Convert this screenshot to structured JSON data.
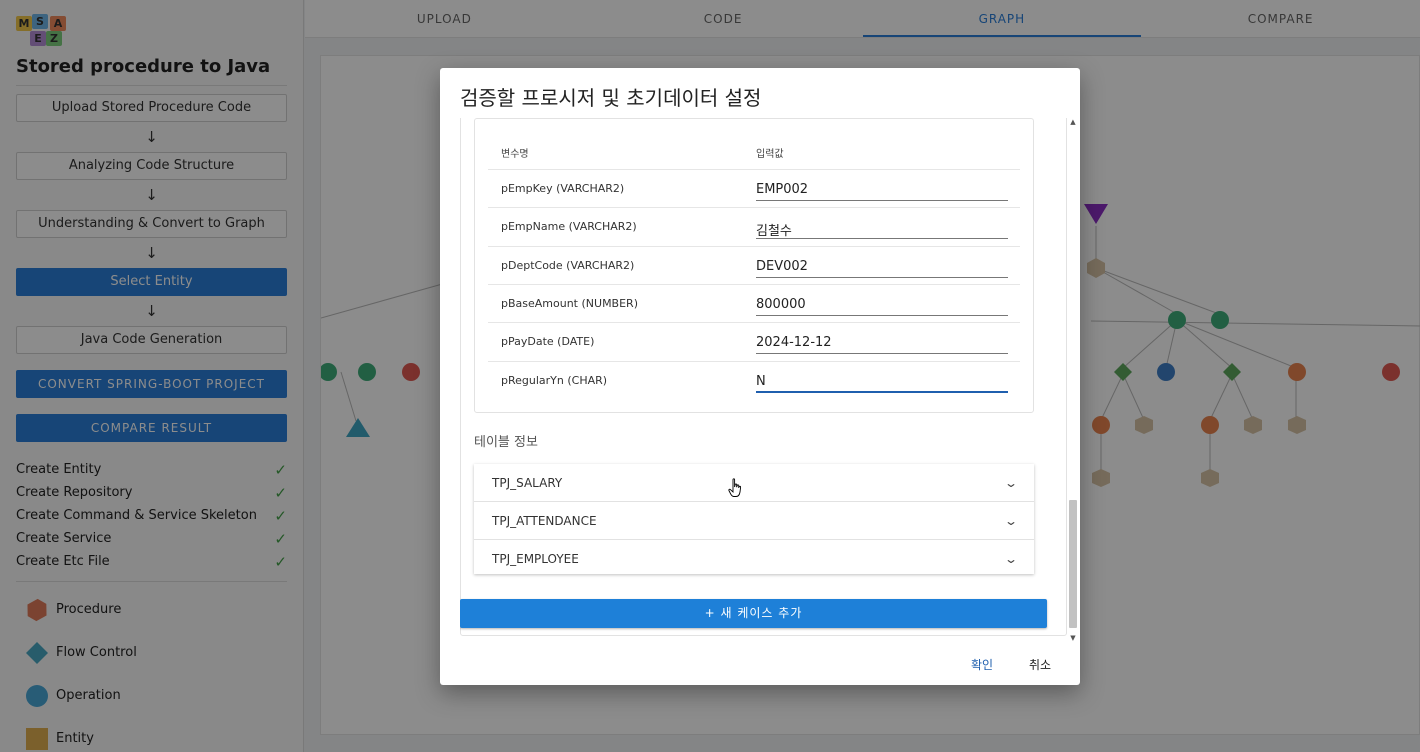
{
  "logo": {
    "letters": [
      "M",
      "S",
      "A",
      "E",
      "Z"
    ]
  },
  "sidebar": {
    "title": "Stored procedure to Java",
    "steps": [
      {
        "label": "Upload Stored Procedure Code",
        "active": false
      },
      {
        "label": "Analyzing Code Structure",
        "active": false
      },
      {
        "label": "Understanding & Convert to Graph",
        "active": false
      },
      {
        "label": "Select Entity",
        "active": true
      },
      {
        "label": "Java Code Generation",
        "active": false
      }
    ],
    "arrow": "↓",
    "actions": [
      "CONVERT SPRING-BOOT PROJECT",
      "COMPARE RESULT"
    ],
    "checklist": [
      {
        "label": "Create Entity",
        "done": true
      },
      {
        "label": "Create Repository",
        "done": true
      },
      {
        "label": "Create Command & Service Skeleton",
        "done": true
      },
      {
        "label": "Create Service",
        "done": true
      },
      {
        "label": "Create Etc File",
        "done": true
      }
    ],
    "check_symbol": "✓",
    "legend": [
      {
        "label": "Procedure",
        "shape": "pentagon-icon",
        "color": "#e07b5a"
      },
      {
        "label": "Flow Control",
        "shape": "diamond-icon",
        "color": "#4aa8c4"
      },
      {
        "label": "Operation",
        "shape": "circle-icon",
        "color": "#4aa8d8"
      },
      {
        "label": "Entity",
        "shape": "square-icon",
        "color": "#e0b050"
      }
    ]
  },
  "tabs": [
    {
      "label": "UPLOAD",
      "active": false
    },
    {
      "label": "CODE",
      "active": false
    },
    {
      "label": "GRAPH",
      "active": true
    },
    {
      "label": "COMPARE",
      "active": false
    }
  ],
  "modal": {
    "title": "검증할 프로시저 및 초기데이터 설정",
    "columns": {
      "name": "변수명",
      "value": "입력값"
    },
    "params": [
      {
        "name": "pEmpKey (VARCHAR2)",
        "value": "EMP002"
      },
      {
        "name": "pEmpName (VARCHAR2)",
        "value": "김철수"
      },
      {
        "name": "pDeptCode (VARCHAR2)",
        "value": "DEV002"
      },
      {
        "name": "pBaseAmount (NUMBER)",
        "value": "800000"
      },
      {
        "name": "pPayDate (DATE)",
        "value": "2024-12-12"
      },
      {
        "name": "pRegularYn (CHAR)",
        "value": "N"
      }
    ],
    "table_section_label": "테이블 정보",
    "tables": [
      "TPJ_SALARY",
      "TPJ_ATTENDANCE",
      "TPJ_EMPLOYEE"
    ],
    "chevron": "⌄",
    "add_case_label": "+ 새 케이스 추가",
    "confirm_label": "확인",
    "cancel_label": "취소"
  },
  "colors": {
    "primary": "#2a7fd9",
    "node_green": "#3fae7a",
    "node_red": "#e05a52",
    "node_orange": "#e9834f",
    "node_blue": "#3f7fc6",
    "node_purple": "#8a2fc4",
    "node_tan": "#d7c3a6"
  }
}
